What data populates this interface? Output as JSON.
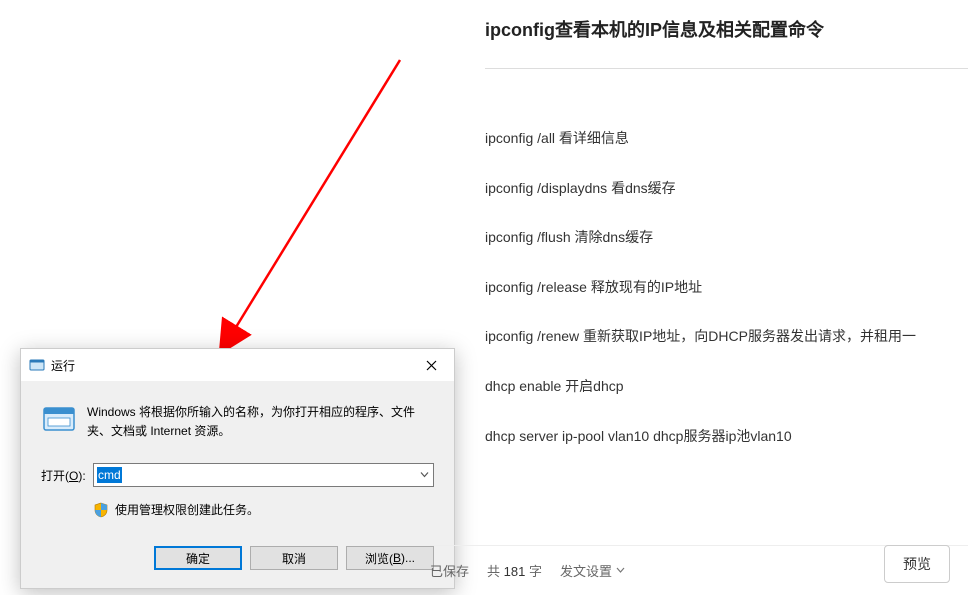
{
  "article": {
    "title": "ipconfig查看本机的IP信息及相关配置命令",
    "lines": [
      "ipconfig /all 看详细信息",
      "ipconfig /displaydns 看dns缓存",
      "ipconfig /flush 清除dns缓存",
      "ipconfig /release 释放现有的IP地址",
      "ipconfig /renew 重新获取IP地址，向DHCP服务器发出请求，并租用一",
      "dhcp enable 开启dhcp",
      "dhcp server ip-pool vlan10 dhcp服务器ip池vlan10"
    ]
  },
  "run_dialog": {
    "title": "运行",
    "description": "Windows 将根据你所输入的名称，为你打开相应的程序、文件夹、文档或 Internet 资源。",
    "open_label_prefix": "打开(",
    "open_label_key": "O",
    "open_label_suffix": "):",
    "open_value": "cmd",
    "admin_note": "使用管理权限创建此任务。",
    "buttons": {
      "ok": "确定",
      "cancel": "取消",
      "browse_prefix": "浏览(",
      "browse_key": "B",
      "browse_suffix": ")..."
    }
  },
  "statusbar": {
    "saved": "已保存",
    "wc_prefix": "共 ",
    "wc_count": "181",
    "wc_suffix": " 字",
    "settings": "发文设置",
    "preview": "预览"
  }
}
